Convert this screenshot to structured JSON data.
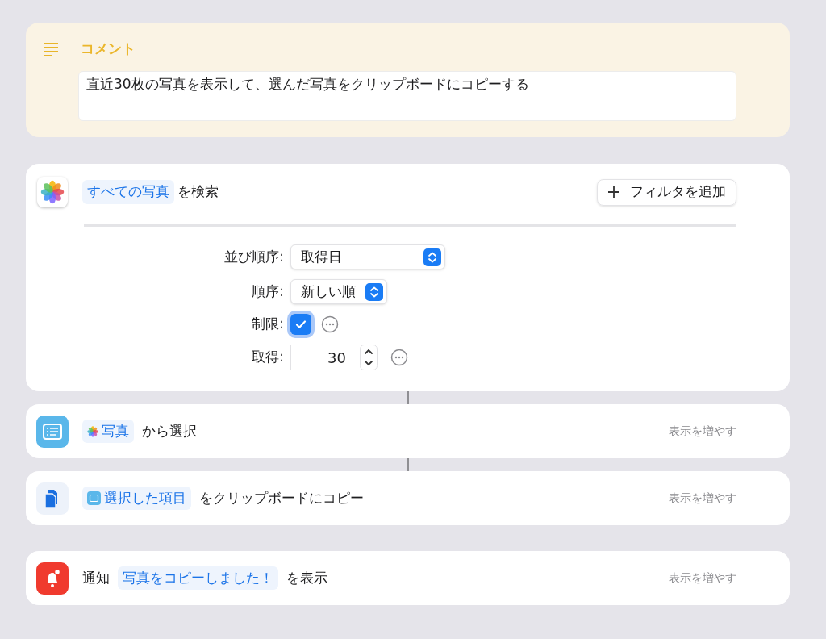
{
  "comment": {
    "title": "コメント",
    "text": "直近30枚の写真を表示して、選んだ写真をクリップボードにコピーする"
  },
  "search_action": {
    "token": "すべての写真",
    "text": "を検索",
    "filter_button": "フィルタを追加",
    "options": [
      {
        "kind": "select",
        "label": "並び順序:",
        "value": "取得日"
      },
      {
        "kind": "select",
        "label": "順序:",
        "value": "新しい順"
      },
      {
        "kind": "checkbox",
        "label": "制限:",
        "checked": true
      },
      {
        "kind": "stepper",
        "label": "取得:",
        "value": "30"
      }
    ]
  },
  "actions": [
    {
      "kind": "choose",
      "connected_above": true,
      "parts": [
        {
          "kind": "photos_token",
          "text": "写真"
        },
        {
          "kind": "text",
          "text": "から選択"
        }
      ],
      "more": "表示を増やす"
    },
    {
      "kind": "copy",
      "connected_above": true,
      "parts": [
        {
          "kind": "list_token",
          "text": "選択した項目"
        },
        {
          "kind": "text",
          "text": "をクリップボードにコピー"
        }
      ],
      "more": "表示を増やす"
    },
    {
      "kind": "notify",
      "connected_above": false,
      "parts": [
        {
          "kind": "text",
          "text": "通知"
        },
        {
          "kind": "token",
          "text": "写真をコピーしました！"
        },
        {
          "kind": "text",
          "text": "を表示"
        }
      ],
      "more": "表示を増やす"
    }
  ]
}
